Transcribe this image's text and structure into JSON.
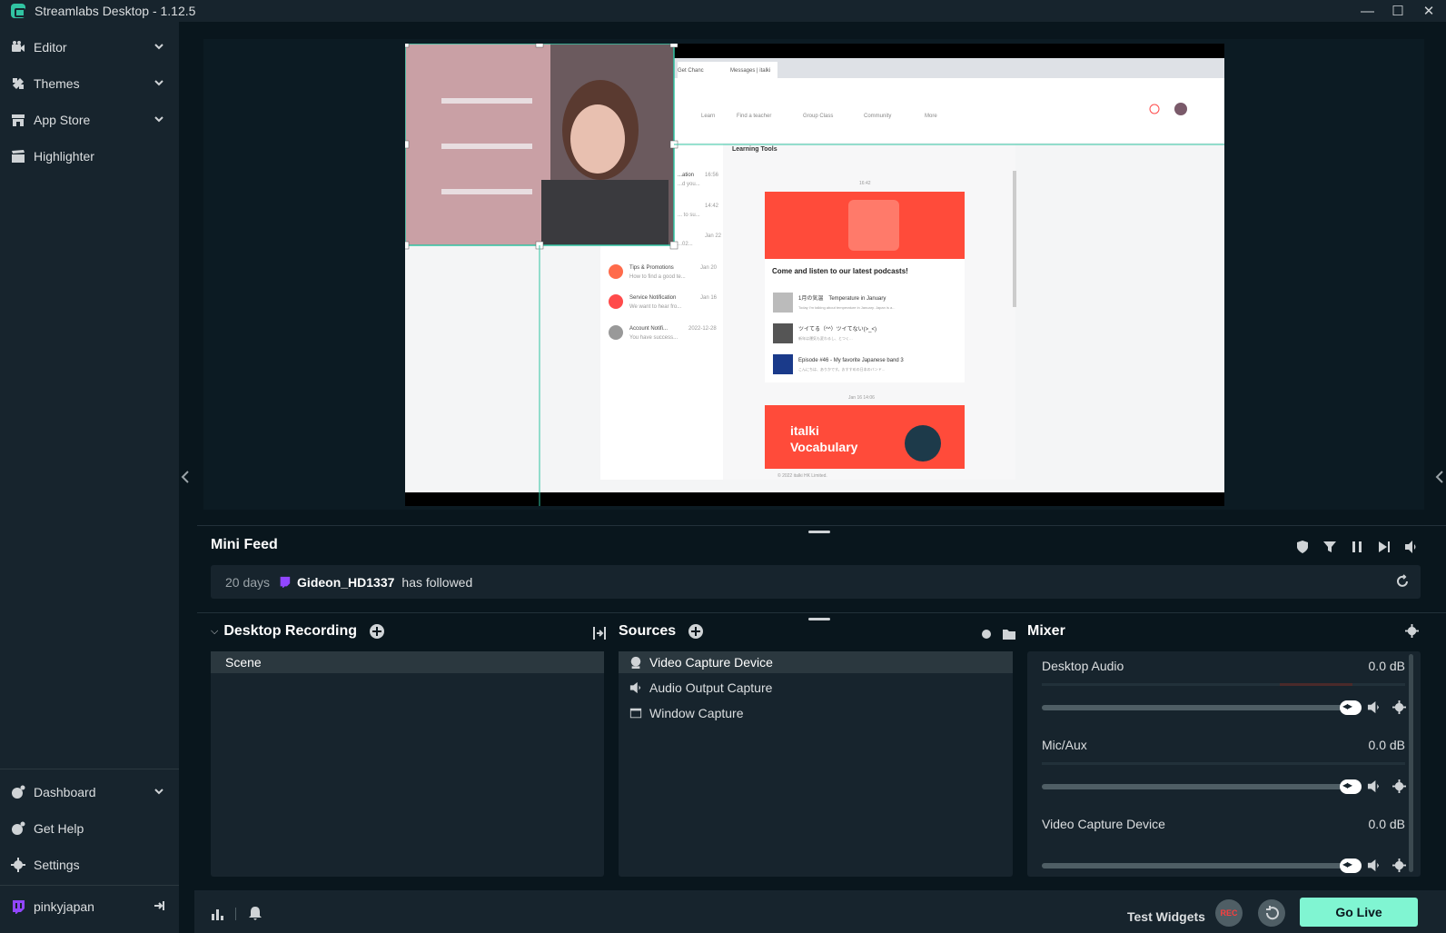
{
  "window": {
    "title": "Streamlabs Desktop - 1.12.5"
  },
  "sidebar": {
    "items": [
      {
        "label": "Editor",
        "icon": "video-camera-icon"
      },
      {
        "label": "Themes",
        "icon": "themes-icon"
      },
      {
        "label": "App Store",
        "icon": "store-icon"
      },
      {
        "label": "Highlighter",
        "icon": "clapperboard-icon"
      }
    ],
    "bottom_items": [
      {
        "label": "Dashboard",
        "icon": "dashboard-icon"
      },
      {
        "label": "Get Help",
        "icon": "help-icon"
      },
      {
        "label": "Settings",
        "icon": "gear-icon"
      }
    ],
    "account": {
      "label": "pinkyjapan",
      "icon": "twitch-icon"
    }
  },
  "preview": {
    "browser": {
      "tab_1": "Get Chanc",
      "tab_2": "Messages | italki",
      "nav": [
        "Learn",
        "Find a teacher",
        "Group Class",
        "Community",
        "More"
      ],
      "learning_tools": "Learning Tools",
      "messages": [
        {
          "title": "...ation",
          "time": "16:56",
          "sub": "...d you..."
        },
        {
          "title": "...",
          "time": "14:42",
          "sub": "... to su..."
        },
        {
          "title": "...",
          "time": "Jan 22",
          "sub": "...02..."
        },
        {
          "title": "Tips & Promotions",
          "time": "Jan 20",
          "sub": "How to find a good te..."
        },
        {
          "title": "Service Notification",
          "time": "Jan 16",
          "sub": "We want to hear fro..."
        },
        {
          "title": "Account Notifi...",
          "time": "2022-12-28",
          "sub": "You have success..."
        }
      ],
      "chat_time_1": "16:42",
      "podcast_title": "Come and listen to our latest podcasts!",
      "podcasts": [
        {
          "title": "1月の気温　Temperature in January",
          "sub": "Today I'm talking about temperature in January. Japan is a..."
        },
        {
          "title": "ツイてる（^^）ツイてない(>_<)",
          "sub": "新年は運気も変わるし、とつく…"
        },
        {
          "title": "Episode #46 - My favorite Japanese band 3",
          "sub": "こんにちは、ありかです。おすすめの日本のバンド..."
        }
      ],
      "chat_time_2": "Jan 16 14:06",
      "banner_line_1": "italki",
      "banner_line_2": "Vocabulary",
      "copyright": "© 2022 italki HK Limited."
    }
  },
  "mini_feed": {
    "title": "Mini Feed",
    "event": {
      "age": "20 days",
      "user": "Gideon_HD1337",
      "action": "has followed"
    }
  },
  "scenes": {
    "title": "Desktop Recording",
    "items": [
      "Scene"
    ]
  },
  "sources": {
    "title": "Sources",
    "items": [
      {
        "label": "Video Capture Device",
        "icon": "camera-icon"
      },
      {
        "label": "Audio Output Capture",
        "icon": "speaker-icon"
      },
      {
        "label": "Window Capture",
        "icon": "window-icon"
      }
    ]
  },
  "mixer": {
    "title": "Mixer",
    "channels": [
      {
        "name": "Desktop Audio",
        "db": "0.0 dB",
        "volume": 1.0
      },
      {
        "name": "Mic/Aux",
        "db": "0.0 dB",
        "volume": 1.0
      },
      {
        "name": "Video Capture Device",
        "db": "0.0 dB",
        "volume": 1.0
      }
    ]
  },
  "footer": {
    "test_widgets": "Test Widgets",
    "rec": "REC",
    "go_live": "Go Live"
  },
  "colors": {
    "accent": "#80f5d2",
    "background": "#09161d",
    "panel": "#17242d",
    "rec": "#fc3e3e",
    "twitch": "#9146ff"
  }
}
